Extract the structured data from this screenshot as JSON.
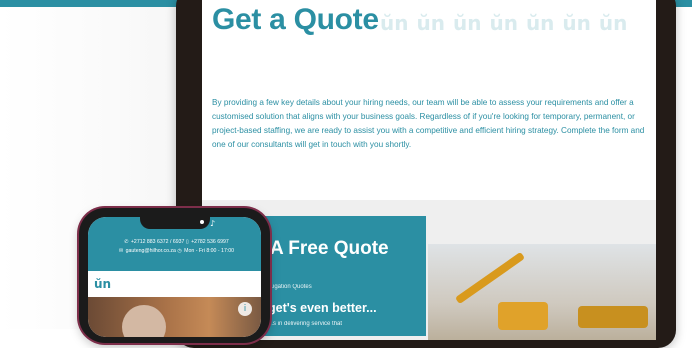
{
  "tablet": {
    "heading": "Get a Quote",
    "brand_pattern": [
      "ŭn",
      "ŭn",
      "ŭn",
      "ŭn",
      "ŭn",
      "ŭn",
      "ŭn"
    ],
    "intro": "By providing a few key details about your hiring needs, our team will be able to assess your requirements and offer a customised solution that aligns with your business goals. Regardless of if you're looking for temporary, permanent, or project-based staffing, we are ready to assist you with a competitive and efficient hiring strategy. Complete the form and one of our consultants will get in touch with you shortly."
  },
  "quote_card": {
    "title": "A Free Quote",
    "subtitle": "...igation Quotes",
    "heading2": "get's even better...",
    "paragraph": "...s in delivering service that"
  },
  "phone": {
    "phone_numbers": "+2712 883 6372 / 6937",
    "mobile": "+2782 536 6997",
    "email": "gauteng@hilhor.co.za",
    "hours": "Mon - Fri 8:00 - 17:00",
    "logo": "ŭn",
    "social_icon": "♪",
    "badge_icon": "i"
  },
  "colors": {
    "brand_teal": "#2b8fa3",
    "device_frame": "#231b17",
    "phone_accent": "#7d2e4a"
  },
  "icons": {
    "phone": "phone-icon",
    "mobile": "mobile-icon",
    "email": "email-icon",
    "clock": "clock-icon"
  }
}
